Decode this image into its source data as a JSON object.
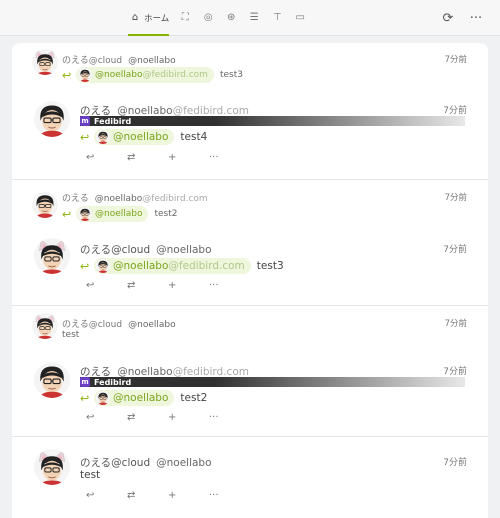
{
  "header": {
    "tabs": [
      {
        "icon": "home-icon",
        "glyph": "⌂",
        "label": "ホーム",
        "active": true
      },
      {
        "icon": "local-timeline-icon",
        "glyph": "⛶",
        "label": ""
      },
      {
        "icon": "social-timeline-icon",
        "glyph": "◎",
        "label": ""
      },
      {
        "icon": "global-timeline-icon",
        "glyph": "⊛",
        "label": ""
      },
      {
        "icon": "list-icon",
        "glyph": "☰",
        "label": ""
      },
      {
        "icon": "antenna-icon",
        "glyph": "⊤",
        "label": ""
      },
      {
        "icon": "channel-icon",
        "glyph": "▭",
        "label": ""
      }
    ],
    "reload_glyph": "⟳",
    "more_glyph": "···"
  },
  "colors": {
    "accent": "#86b300",
    "mention_bg": "#eef6dc",
    "fedibird": "#6b3fc4"
  },
  "actions": {
    "reply": "↩",
    "renote": "⇄",
    "react": "+",
    "more": "···"
  },
  "notes": [
    {
      "parent": {
        "name": "のえる@cloud",
        "username": "@noellabo",
        "host": "",
        "time": "7分前",
        "mention_user": "@noellabo",
        "mention_host": "@fedibird.com",
        "text": "test3"
      },
      "main": {
        "name": "のえる",
        "username": "@noellabo",
        "host": "@fedibird.com",
        "time": "7分前",
        "instance": "Fedibird",
        "mention_user": "@noellabo",
        "mention_host": "",
        "text": "test4"
      }
    },
    {
      "parent": {
        "name": "のえる",
        "username": "@noellabo",
        "host": "@fedibird.com",
        "time": "7分前",
        "mention_user": "@noellabo",
        "mention_host": "",
        "text": "test2"
      },
      "main": {
        "name": "のえる@cloud",
        "username": "@noellabo",
        "host": "",
        "time": "7分前",
        "mention_user": "@noellabo",
        "mention_host": "@fedibird.com",
        "text": "test3"
      }
    },
    {
      "parent": {
        "name": "のえる@cloud",
        "username": "@noellabo",
        "host": "",
        "time": "7分前",
        "text": "test"
      },
      "main": {
        "name": "のえる",
        "username": "@noellabo",
        "host": "@fedibird.com",
        "time": "7分前",
        "instance": "Fedibird",
        "mention_user": "@noellabo",
        "mention_host": "",
        "text": "test2"
      }
    },
    {
      "main": {
        "name": "のえる@cloud",
        "username": "@noellabo",
        "host": "",
        "time": "7分前",
        "text": "test"
      }
    }
  ]
}
